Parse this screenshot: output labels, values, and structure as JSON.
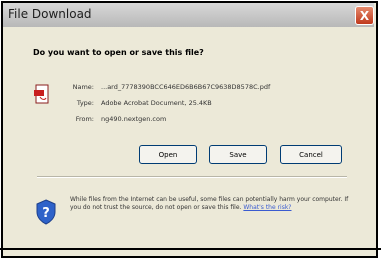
{
  "window": {
    "title": "File Download",
    "close_label": "X"
  },
  "prompt": {
    "question": "Do you want to open or save this file?"
  },
  "file": {
    "name_label": "Name:",
    "name_value": "...ard_7778390BCC646ED6B6B67C9638D8578C.pdf",
    "type_label": "Type:",
    "type_value": "Adobe Acrobat Document, 25.4KB",
    "from_label": "From:",
    "from_value": "ng490.nextgen.com"
  },
  "buttons": {
    "open": "Open",
    "save": "Save",
    "cancel": "Cancel"
  },
  "warning": {
    "text": "While files from the Internet can be useful, some files can potentially harm your computer. If you do not trust the source, do not open or save this file.",
    "link": "What's the risk?"
  },
  "icons": {
    "file": "pdf-file-icon",
    "shield": "security-shield-icon"
  },
  "colors": {
    "close": "#c0391c",
    "link": "#3a5bd0",
    "button_border": "#003c74"
  }
}
